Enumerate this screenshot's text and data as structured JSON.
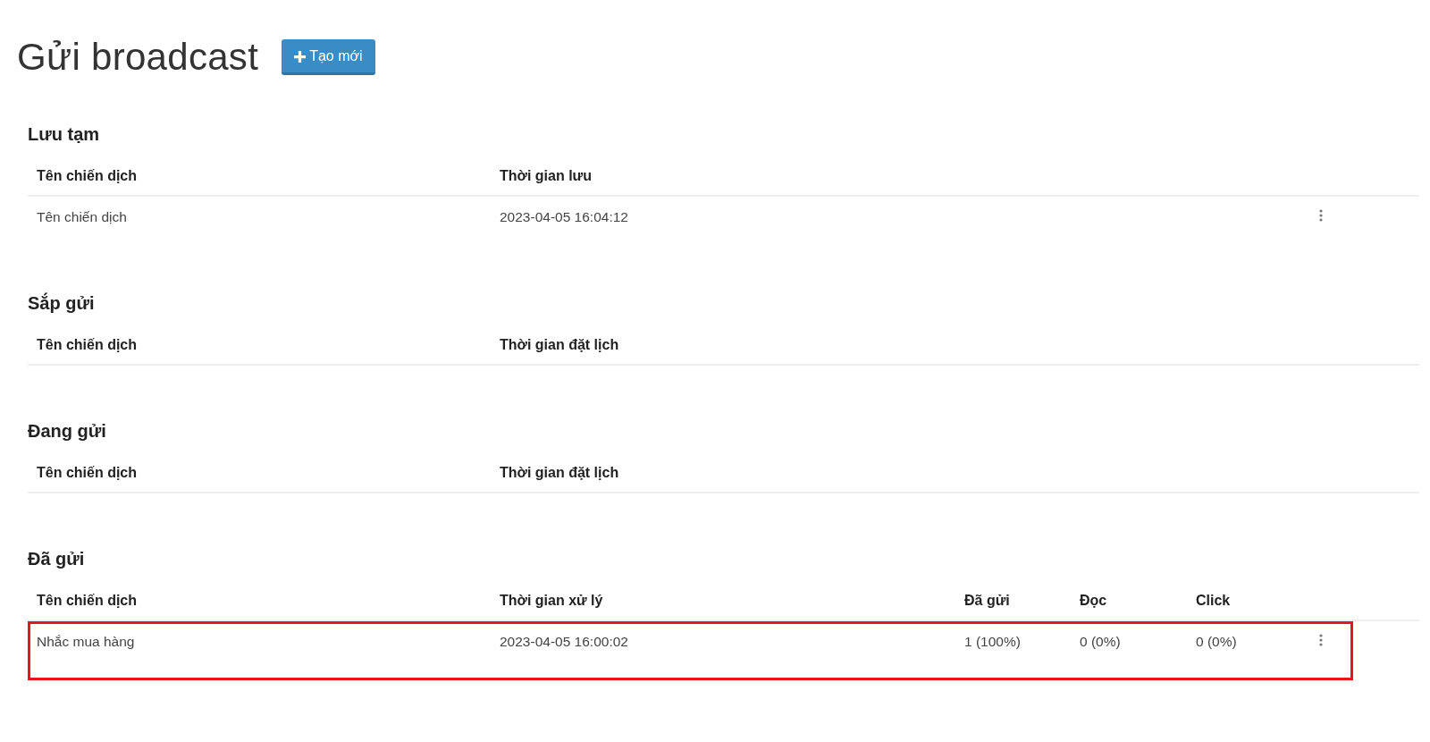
{
  "page_title": "Gửi broadcast",
  "create_button": {
    "label": "Tạo mới"
  },
  "sections": [
    {
      "heading": "Lưu tạm",
      "columns": [
        "Tên chiến dịch",
        "Thời gian lưu"
      ],
      "rows": [
        {
          "cells": [
            "Tên chiến dịch",
            "2023-04-05 16:04:12"
          ],
          "menu": true,
          "highlighted": false
        }
      ]
    },
    {
      "heading": "Sắp gửi",
      "columns": [
        "Tên chiến dịch",
        "Thời gian đặt lịch"
      ]
    },
    {
      "heading": "Đang gửi",
      "columns": [
        "Tên chiến dịch",
        "Thời gian đặt lịch"
      ]
    },
    {
      "heading": "Đã gửi",
      "columns": [
        "Tên chiến dịch",
        "Thời gian xử lý",
        "Đã gửi",
        "Đọc",
        "Click"
      ],
      "rows": [
        {
          "cells": [
            "Nhắc mua hàng",
            "2023-04-05 16:00:02",
            "1 (100%)",
            "0 (0%)",
            "0 (0%)"
          ],
          "menu": true,
          "highlighted": true
        }
      ]
    }
  ]
}
